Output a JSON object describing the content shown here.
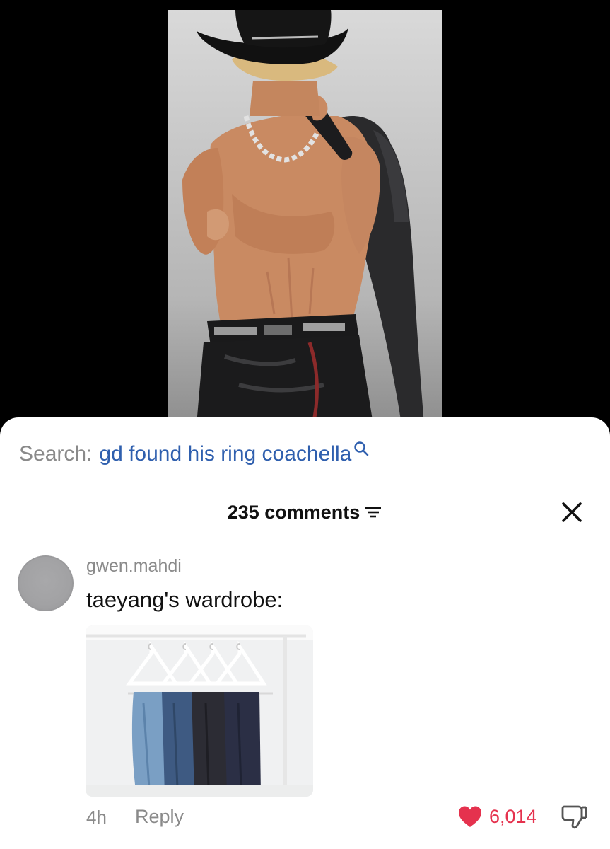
{
  "video": {
    "media_icon": "performer-on-stage-video"
  },
  "search": {
    "prefix": "Search:",
    "query": "gd found his ring coachella",
    "icon": "search-icon",
    "color": "#2f5fae"
  },
  "comments_panel": {
    "count_label": "235 comments",
    "filter_icon": "sort-lines-icon",
    "close_icon": "close-icon"
  },
  "comment": {
    "username": "gwen.mahdi",
    "text": "taeyang's wardrobe:",
    "image_description_icon": "jeans-on-clothing-rack-image",
    "timestamp": "4h",
    "reply_label": "Reply",
    "likes": "6,014",
    "liked": true,
    "like_color": "#e5324e",
    "dislike_icon": "thumbs-down-icon"
  }
}
